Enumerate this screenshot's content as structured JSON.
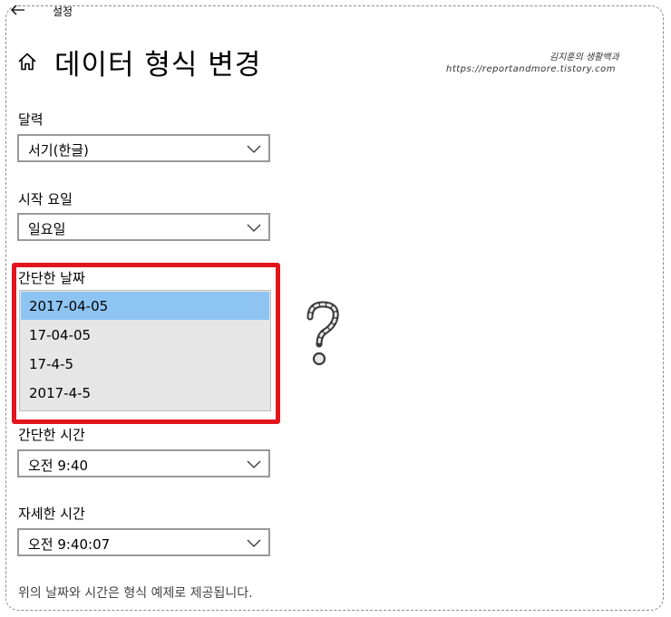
{
  "titlebar": {
    "back_icon": "arrow-left-icon",
    "title": "설정"
  },
  "page": {
    "home_icon": "home-icon",
    "title": "데이터 형식 변경"
  },
  "watermark": {
    "name": "김지훈의 생활백과",
    "url": "https://reportandmore.tistory.com"
  },
  "fields": {
    "calendar": {
      "label": "달력",
      "value": "서기(한글)"
    },
    "first_day": {
      "label": "시작 요일",
      "value": "일요일"
    },
    "short_date": {
      "label": "간단한 날짜",
      "options": [
        "2017-04-05",
        "17-04-05",
        "17-4-5",
        "2017-4-5"
      ],
      "selected_index": 0
    },
    "short_time": {
      "label": "간단한 시간",
      "value": "오전 9:40"
    },
    "long_time": {
      "label": "자세한 시간",
      "value": "오전 9:40:07"
    }
  },
  "footer": {
    "note": "위의 날짜와 시간은 형식 예제로 제공됩니다."
  },
  "colors": {
    "highlight": "#e3151c",
    "selected_option": "#8ec4f2",
    "dropdown_bg": "#e6e6e6"
  },
  "annotation": {
    "icon": "question-mark-icon"
  }
}
